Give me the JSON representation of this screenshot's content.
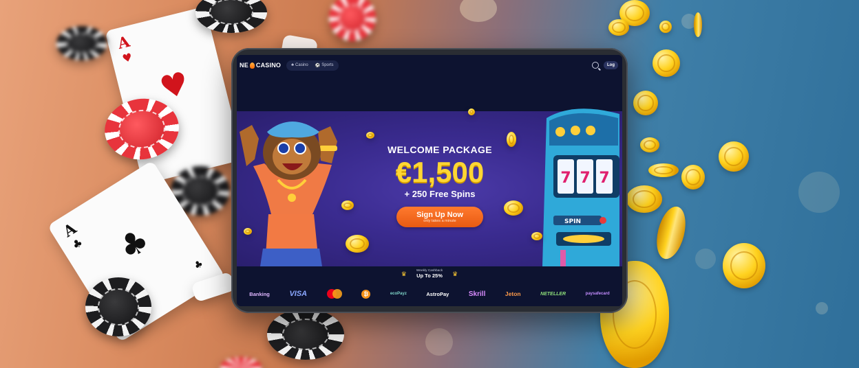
{
  "site": {
    "logo_text": "NE",
    "logo_word": "CASINO",
    "nav": [
      {
        "label": "Casino",
        "icon": "casino-icon"
      },
      {
        "label": "Sports",
        "icon": "sports-ball-icon"
      }
    ],
    "login_label": "Log"
  },
  "hero": {
    "welcome": "WELCOME PACKAGE",
    "amount": "€1,500",
    "spins": "+ 250 Free Spins",
    "cta_label": "Sign Up Now",
    "cta_sub": "only takes a minute",
    "slot_button": "SPIN"
  },
  "cashback": {
    "small": "Weekly Cashback",
    "big": "Up To 25%"
  },
  "payments": [
    "Banking",
    "VISA",
    "mastercard",
    "bitcoin",
    "ecoPayz",
    "AstroPay",
    "Skrill",
    "Jeton",
    "NETELLER",
    "paysafe"
  ],
  "payment_labels": {
    "banking": "Banking",
    "visa": "VISA",
    "ecopayz": "ecoPayz",
    "astropay": "AstroPay",
    "skrill": "Skrill",
    "jeton": "Jeton",
    "neteller": "NETELLER",
    "paysafe": "paysafecard"
  },
  "colors": {
    "accent_orange": "#ff7a2e",
    "amount_yellow": "#ffd633",
    "screen_bg": "#0d1330",
    "hero_purple": "#3a2b8f"
  },
  "decor": {
    "card_ace_hearts": {
      "rank": "A",
      "suit": "♥"
    },
    "card_ace_clubs": {
      "rank": "A",
      "suit": "♣"
    }
  }
}
